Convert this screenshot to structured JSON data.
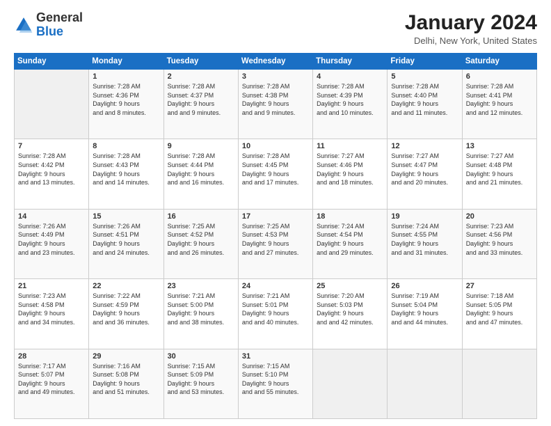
{
  "header": {
    "logo_line1": "General",
    "logo_line2": "Blue",
    "title": "January 2024",
    "location": "Delhi, New York, United States"
  },
  "columns": [
    "Sunday",
    "Monday",
    "Tuesday",
    "Wednesday",
    "Thursday",
    "Friday",
    "Saturday"
  ],
  "weeks": [
    [
      {
        "num": "",
        "empty": true
      },
      {
        "num": "1",
        "sunrise": "Sunrise: 7:28 AM",
        "sunset": "Sunset: 4:36 PM",
        "daylight": "Daylight: 9 hours and 8 minutes."
      },
      {
        "num": "2",
        "sunrise": "Sunrise: 7:28 AM",
        "sunset": "Sunset: 4:37 PM",
        "daylight": "Daylight: 9 hours and 9 minutes."
      },
      {
        "num": "3",
        "sunrise": "Sunrise: 7:28 AM",
        "sunset": "Sunset: 4:38 PM",
        "daylight": "Daylight: 9 hours and 9 minutes."
      },
      {
        "num": "4",
        "sunrise": "Sunrise: 7:28 AM",
        "sunset": "Sunset: 4:39 PM",
        "daylight": "Daylight: 9 hours and 10 minutes."
      },
      {
        "num": "5",
        "sunrise": "Sunrise: 7:28 AM",
        "sunset": "Sunset: 4:40 PM",
        "daylight": "Daylight: 9 hours and 11 minutes."
      },
      {
        "num": "6",
        "sunrise": "Sunrise: 7:28 AM",
        "sunset": "Sunset: 4:41 PM",
        "daylight": "Daylight: 9 hours and 12 minutes."
      }
    ],
    [
      {
        "num": "7",
        "sunrise": "Sunrise: 7:28 AM",
        "sunset": "Sunset: 4:42 PM",
        "daylight": "Daylight: 9 hours and 13 minutes."
      },
      {
        "num": "8",
        "sunrise": "Sunrise: 7:28 AM",
        "sunset": "Sunset: 4:43 PM",
        "daylight": "Daylight: 9 hours and 14 minutes."
      },
      {
        "num": "9",
        "sunrise": "Sunrise: 7:28 AM",
        "sunset": "Sunset: 4:44 PM",
        "daylight": "Daylight: 9 hours and 16 minutes."
      },
      {
        "num": "10",
        "sunrise": "Sunrise: 7:28 AM",
        "sunset": "Sunset: 4:45 PM",
        "daylight": "Daylight: 9 hours and 17 minutes."
      },
      {
        "num": "11",
        "sunrise": "Sunrise: 7:27 AM",
        "sunset": "Sunset: 4:46 PM",
        "daylight": "Daylight: 9 hours and 18 minutes."
      },
      {
        "num": "12",
        "sunrise": "Sunrise: 7:27 AM",
        "sunset": "Sunset: 4:47 PM",
        "daylight": "Daylight: 9 hours and 20 minutes."
      },
      {
        "num": "13",
        "sunrise": "Sunrise: 7:27 AM",
        "sunset": "Sunset: 4:48 PM",
        "daylight": "Daylight: 9 hours and 21 minutes."
      }
    ],
    [
      {
        "num": "14",
        "sunrise": "Sunrise: 7:26 AM",
        "sunset": "Sunset: 4:49 PM",
        "daylight": "Daylight: 9 hours and 23 minutes."
      },
      {
        "num": "15",
        "sunrise": "Sunrise: 7:26 AM",
        "sunset": "Sunset: 4:51 PM",
        "daylight": "Daylight: 9 hours and 24 minutes."
      },
      {
        "num": "16",
        "sunrise": "Sunrise: 7:25 AM",
        "sunset": "Sunset: 4:52 PM",
        "daylight": "Daylight: 9 hours and 26 minutes."
      },
      {
        "num": "17",
        "sunrise": "Sunrise: 7:25 AM",
        "sunset": "Sunset: 4:53 PM",
        "daylight": "Daylight: 9 hours and 27 minutes."
      },
      {
        "num": "18",
        "sunrise": "Sunrise: 7:24 AM",
        "sunset": "Sunset: 4:54 PM",
        "daylight": "Daylight: 9 hours and 29 minutes."
      },
      {
        "num": "19",
        "sunrise": "Sunrise: 7:24 AM",
        "sunset": "Sunset: 4:55 PM",
        "daylight": "Daylight: 9 hours and 31 minutes."
      },
      {
        "num": "20",
        "sunrise": "Sunrise: 7:23 AM",
        "sunset": "Sunset: 4:56 PM",
        "daylight": "Daylight: 9 hours and 33 minutes."
      }
    ],
    [
      {
        "num": "21",
        "sunrise": "Sunrise: 7:23 AM",
        "sunset": "Sunset: 4:58 PM",
        "daylight": "Daylight: 9 hours and 34 minutes."
      },
      {
        "num": "22",
        "sunrise": "Sunrise: 7:22 AM",
        "sunset": "Sunset: 4:59 PM",
        "daylight": "Daylight: 9 hours and 36 minutes."
      },
      {
        "num": "23",
        "sunrise": "Sunrise: 7:21 AM",
        "sunset": "Sunset: 5:00 PM",
        "daylight": "Daylight: 9 hours and 38 minutes."
      },
      {
        "num": "24",
        "sunrise": "Sunrise: 7:21 AM",
        "sunset": "Sunset: 5:01 PM",
        "daylight": "Daylight: 9 hours and 40 minutes."
      },
      {
        "num": "25",
        "sunrise": "Sunrise: 7:20 AM",
        "sunset": "Sunset: 5:03 PM",
        "daylight": "Daylight: 9 hours and 42 minutes."
      },
      {
        "num": "26",
        "sunrise": "Sunrise: 7:19 AM",
        "sunset": "Sunset: 5:04 PM",
        "daylight": "Daylight: 9 hours and 44 minutes."
      },
      {
        "num": "27",
        "sunrise": "Sunrise: 7:18 AM",
        "sunset": "Sunset: 5:05 PM",
        "daylight": "Daylight: 9 hours and 47 minutes."
      }
    ],
    [
      {
        "num": "28",
        "sunrise": "Sunrise: 7:17 AM",
        "sunset": "Sunset: 5:07 PM",
        "daylight": "Daylight: 9 hours and 49 minutes."
      },
      {
        "num": "29",
        "sunrise": "Sunrise: 7:16 AM",
        "sunset": "Sunset: 5:08 PM",
        "daylight": "Daylight: 9 hours and 51 minutes."
      },
      {
        "num": "30",
        "sunrise": "Sunrise: 7:15 AM",
        "sunset": "Sunset: 5:09 PM",
        "daylight": "Daylight: 9 hours and 53 minutes."
      },
      {
        "num": "31",
        "sunrise": "Sunrise: 7:15 AM",
        "sunset": "Sunset: 5:10 PM",
        "daylight": "Daylight: 9 hours and 55 minutes."
      },
      {
        "num": "",
        "empty": true
      },
      {
        "num": "",
        "empty": true
      },
      {
        "num": "",
        "empty": true
      }
    ]
  ]
}
